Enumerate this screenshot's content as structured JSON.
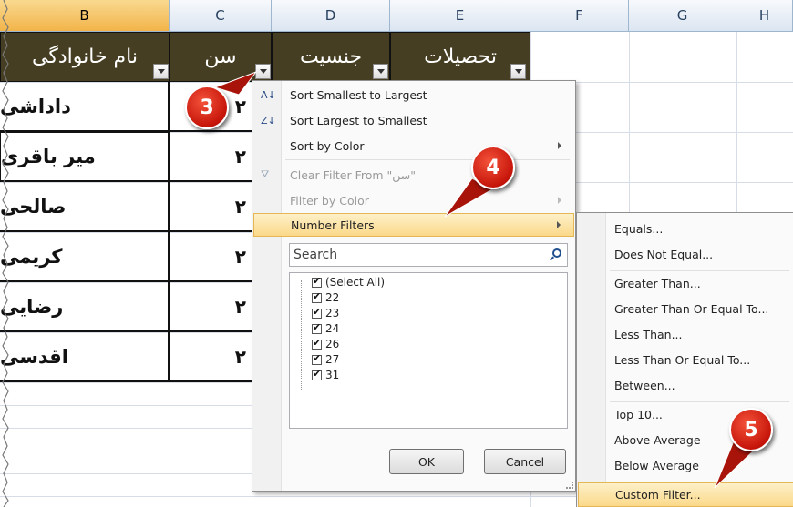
{
  "columns": [
    "B",
    "C",
    "D",
    "E",
    "F",
    "G",
    "H"
  ],
  "selected_column": "B",
  "header_row": [
    "نام خانوادگی",
    "سن",
    "جنسیت",
    "تحصیلات"
  ],
  "rows": [
    {
      "family": "داداشی",
      "age": "۲"
    },
    {
      "family": "میر باقری",
      "age": "۲"
    },
    {
      "family": "صالحی",
      "age": "۲"
    },
    {
      "family": "کریمی",
      "age": "۲"
    },
    {
      "family": "رضایی",
      "age": "۲"
    },
    {
      "family": "اقدسی",
      "age": "۲"
    }
  ],
  "filter_menu": {
    "items": [
      {
        "label": "Sort Smallest to Largest",
        "icon": "sort-ascending-icon",
        "glyph": "A↓",
        "enabled": true,
        "submenu": false
      },
      {
        "label": "Sort Largest to Smallest",
        "icon": "sort-descending-icon",
        "glyph": "Z↓",
        "enabled": true,
        "submenu": false
      },
      {
        "label": "Sort by Color",
        "icon": "",
        "glyph": "",
        "enabled": true,
        "submenu": true
      },
      {
        "label": "Clear Filter From \"سن\"",
        "icon": "clear-filter-icon",
        "glyph": "⛛",
        "enabled": false,
        "submenu": false
      },
      {
        "label": "Filter by Color",
        "icon": "",
        "glyph": "",
        "enabled": false,
        "submenu": true
      },
      {
        "label": "Number Filters",
        "icon": "",
        "glyph": "",
        "enabled": true,
        "submenu": true,
        "highlighted": true
      }
    ],
    "search_placeholder": "Search",
    "values": [
      "(Select All)",
      "22",
      "23",
      "24",
      "26",
      "27",
      "31"
    ],
    "ok_label": "OK",
    "cancel_label": "Cancel"
  },
  "number_filters_submenu": [
    "Equals...",
    "Does Not Equal...",
    "Greater Than...",
    "Greater Than Or Equal To...",
    "Less Than...",
    "Less Than Or Equal To...",
    "Between...",
    "Top 10...",
    "Above Average",
    "Below Average",
    "Custom Filter..."
  ],
  "callouts": [
    "3",
    "4",
    "5"
  ],
  "colors": {
    "header_fill": "#463e22",
    "highlight": "#fbd98a",
    "callout": "#d0180c"
  }
}
